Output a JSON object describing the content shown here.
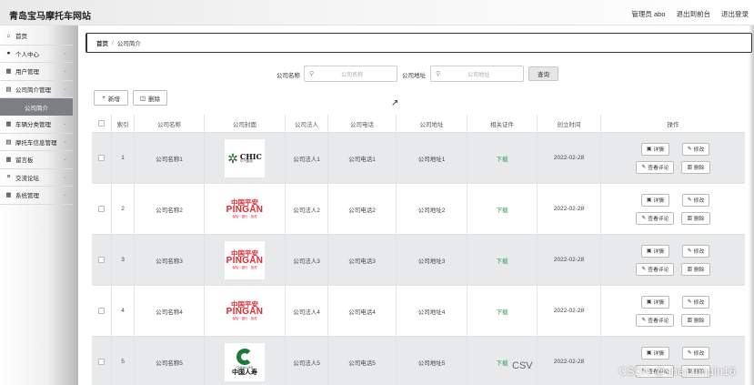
{
  "header": {
    "site_title": "青岛宝马摩托车网站",
    "admin_label": "管理员 abo",
    "exit_front": "退出到前台",
    "logout": "退出登录"
  },
  "sidebar": {
    "items": [
      {
        "label": "首页",
        "icon": "home-icon",
        "glyph": "⌂",
        "chevron": false
      },
      {
        "label": "个人中心",
        "icon": "user-icon",
        "glyph": "●",
        "chevron": true
      },
      {
        "label": "用户管理",
        "icon": "grid-icon",
        "glyph": "▦",
        "chevron": true
      },
      {
        "label": "公司简介管理",
        "icon": "doc-icon",
        "glyph": "▤",
        "chevron": true
      },
      {
        "label": "公司简介",
        "sub": true
      },
      {
        "label": "车辆分类管理",
        "icon": "grid-icon",
        "glyph": "▦",
        "chevron": true
      },
      {
        "label": "摩托车信息管理",
        "icon": "doc-icon",
        "glyph": "▤",
        "chevron": true
      },
      {
        "label": "留言板",
        "icon": "grid-icon",
        "glyph": "▦",
        "chevron": true
      },
      {
        "label": "交流论坛",
        "icon": "filter-icon",
        "glyph": "≡",
        "chevron": true
      },
      {
        "label": "系统管理",
        "icon": "grid-icon",
        "glyph": "▦",
        "chevron": true
      }
    ]
  },
  "breadcrumb": {
    "home": "首页",
    "sep": "/",
    "current": "公司简介"
  },
  "search": {
    "name_label": "公司名称",
    "name_placeholder": "公司名称",
    "addr_label": "公司地址",
    "addr_placeholder": "公司地址",
    "query_button": "查询"
  },
  "actions": {
    "add": "新增",
    "delete": "删除"
  },
  "table": {
    "headers": [
      "索引",
      "公司名称",
      "公司封面",
      "公司法人",
      "公司电话",
      "公司地址",
      "相关证件",
      "创立时间",
      "操作"
    ],
    "rows": [
      {
        "index": "1",
        "name": "公司名称1",
        "logo": "chic",
        "legal": "公司法人1",
        "phone": "公司电话1",
        "addr": "公司地址1",
        "cert": "下载",
        "date": "2022-02-28"
      },
      {
        "index": "2",
        "name": "公司名称2",
        "logo": "pingan",
        "legal": "公司法人2",
        "phone": "公司电话2",
        "addr": "公司地址2",
        "cert": "下载",
        "date": "2022-02-28"
      },
      {
        "index": "3",
        "name": "公司名称3",
        "logo": "pingan",
        "legal": "公司法人3",
        "phone": "公司电话3",
        "addr": "公司地址3",
        "cert": "下载",
        "date": "2022-02-28"
      },
      {
        "index": "4",
        "name": "公司名称4",
        "logo": "pingan",
        "legal": "公司法人4",
        "phone": "公司电话4",
        "addr": "公司地址4",
        "cert": "下载",
        "date": "2022-02-28"
      },
      {
        "index": "5",
        "name": "公司名称5",
        "logo": "chinalife",
        "legal": "公司法人5",
        "phone": "公司电话5",
        "addr": "公司地址5",
        "cert": "下载",
        "date": "2022-02-28"
      }
    ],
    "ops": {
      "detail": "详情",
      "edit": "修改",
      "comments": "查看评论",
      "delete": "删除"
    }
  },
  "logos": {
    "chic": {
      "big": "CHIC",
      "small": "华汽集团"
    },
    "pingan": {
      "cn": "中国平安",
      "en": "PINGAN",
      "small": "保险 · 银行 · 投资"
    },
    "chinalife": {
      "en": "CHINA LIFE",
      "cn": "中国人寿"
    }
  },
  "watermark": "CSDN @shejizuopin16",
  "colors": {
    "download": "#2aa05a",
    "pingan_red": "#e3262d",
    "chic_green": "#1a6b30",
    "sidebar_active": "#7b7f84"
  }
}
